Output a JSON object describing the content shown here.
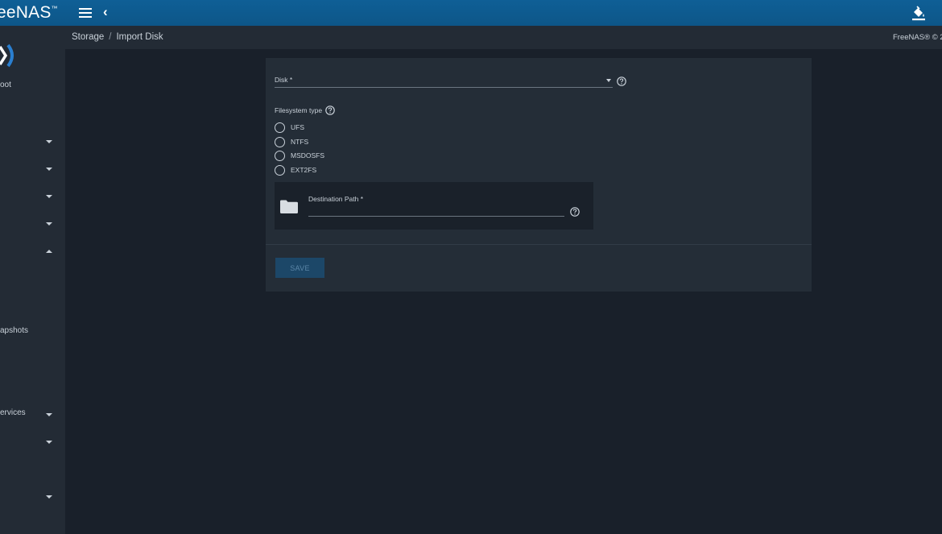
{
  "app": {
    "title": "eeNAS",
    "trademark": "™"
  },
  "breadcrumb": {
    "parent": "Storage",
    "separator": "/",
    "current": "Import Disk"
  },
  "copyright": "FreeNAS® © 2",
  "sidebar": {
    "items": [
      {
        "label": "oot",
        "expandable": false
      },
      {
        "label": "",
        "expandable": true,
        "expanded": false
      },
      {
        "label": "",
        "expandable": true,
        "expanded": false
      },
      {
        "label": "",
        "expandable": true,
        "expanded": false
      },
      {
        "label": "",
        "expandable": true,
        "expanded": false
      },
      {
        "label": "",
        "expandable": true,
        "expanded": true
      },
      {
        "label": "apshots",
        "expandable": false
      },
      {
        "label": "ervices",
        "expandable": true,
        "expanded": false
      },
      {
        "label": "",
        "expandable": true,
        "expanded": false
      },
      {
        "label": "",
        "expandable": true,
        "expanded": false
      }
    ]
  },
  "form": {
    "disk": {
      "label": "Disk *",
      "value": ""
    },
    "filesystem": {
      "label": "Filesystem type",
      "options": [
        "UFS",
        "NTFS",
        "MSDOSFS",
        "EXT2FS"
      ],
      "selected": null
    },
    "destination": {
      "label": "Destination Path *",
      "value": ""
    },
    "save_label": "SAVE"
  },
  "icons": {
    "menu": "menu-icon",
    "back": "chevron-left-icon",
    "theme": "paint-bucket-icon",
    "help": "help-circle-icon",
    "folder": "folder-icon",
    "caret": "caret-down-icon"
  },
  "colors": {
    "topbar": "#0f5f96",
    "sidebar": "#232b35",
    "background": "#19202a",
    "card": "#242d37",
    "save_button": "#1c4768"
  }
}
